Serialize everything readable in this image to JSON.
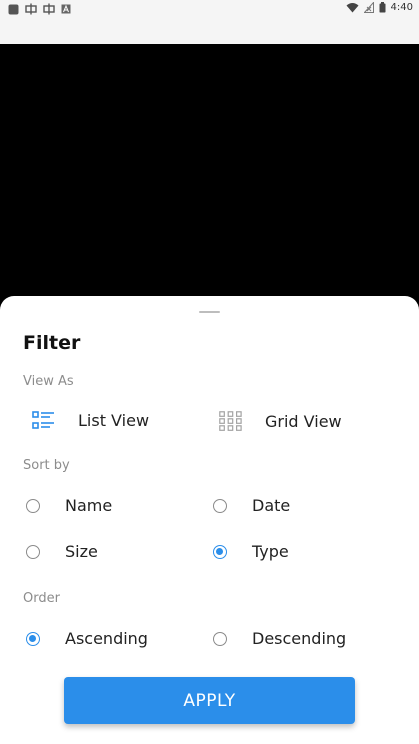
{
  "status_bar": {
    "time": "4:40",
    "left_icons": [
      "square-app-icon",
      "bug-icon",
      "bug-icon",
      "font-a-icon"
    ],
    "right_icons": [
      "wifi-icon",
      "signal-icon",
      "battery-icon"
    ]
  },
  "filter": {
    "title": "Filter",
    "view_as": {
      "label": "View As",
      "options": [
        {
          "label": "List View",
          "icon": "list-view-icon"
        },
        {
          "label": "Grid View",
          "icon": "grid-view-icon"
        }
      ]
    },
    "sort_by": {
      "label": "Sort by",
      "options": [
        {
          "label": "Name",
          "checked": false
        },
        {
          "label": "Date",
          "checked": false
        },
        {
          "label": "Size",
          "checked": false
        },
        {
          "label": "Type",
          "checked": true
        }
      ]
    },
    "order": {
      "label": "Order",
      "options": [
        {
          "label": "Ascending",
          "checked": true
        },
        {
          "label": "Descending",
          "checked": false
        }
      ]
    },
    "apply_label": "APPLY"
  },
  "colors": {
    "accent": "#2b8eea",
    "overlay": "#000000",
    "status_bar_bg": "#f5f5f5"
  }
}
